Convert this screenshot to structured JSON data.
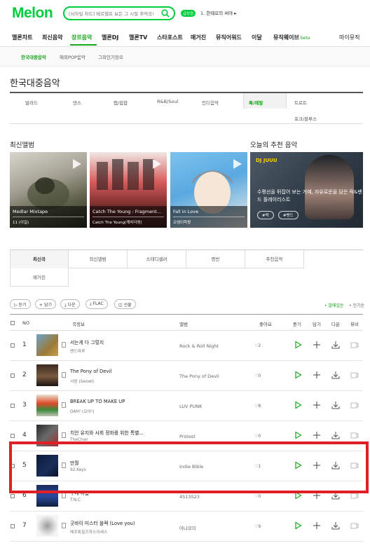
{
  "header": {
    "logo": "Melon",
    "search_placeholder": "[서하빌 차트] 메르헬프 보든 그 시절 추억곡!",
    "badge": "급상승",
    "trend": "1. 한때로의 써야 ▸"
  },
  "gnb": {
    "items": [
      "멜론차트",
      "최신음악",
      "장르음악",
      "멜론DJ",
      "멜론TV",
      "스타포스트",
      "매거진",
      "뮤직어워드",
      "이달",
      "뮤직웨이브",
      "마이뮤직"
    ],
    "beta": "beta"
  },
  "subnav": {
    "items": [
      "한국대중음악",
      "해외POP음악",
      "그외인기장르"
    ]
  },
  "page_title": "한국대중음악",
  "genres": [
    "발라드",
    "댄스",
    "랩/힙합",
    "R&B/Soul",
    "인디음악",
    "록/메탈",
    "트로트",
    "포크/블루스"
  ],
  "sections": {
    "new_albums": "최신앨범",
    "recommend": "오늘의 추천 음악"
  },
  "albums": [
    {
      "title": "Medlar Mixtape",
      "artist": "11 (이일)"
    },
    {
      "title": "Catch The Young : Fragment...",
      "artist": "Catch The Young(캐치더영)"
    },
    {
      "title": "Fall in Love",
      "artist": "오엠이학왕"
    }
  ],
  "recommend": {
    "dj": "DJ JUUU",
    "text": "수평선을 뒤집어 보는 거예, 자유로운을 담은 락&밴드 플레이리스트",
    "tags": [
      "#락",
      "#밴드"
    ]
  },
  "tabs": [
    "최신곡",
    "최신앨범",
    "스테디셀러",
    "명반",
    "추천음악",
    "매거진"
  ],
  "actions": {
    "buttons": [
      "듣기",
      "담기",
      "다운",
      "FLAC",
      "선물"
    ],
    "toggle_on": "• 발매일순",
    "toggle_off": "• 인기순"
  },
  "table": {
    "headers": [
      "NO",
      "곡정보",
      "앨범",
      "좋아요",
      "듣기",
      "담기",
      "다운",
      "뮤비"
    ],
    "rows": [
      {
        "rank": "1",
        "title": "서는게 다 그렇지",
        "artist": "밴드마루",
        "album": "Rock & Roll Night",
        "likes": "2"
      },
      {
        "rank": "2",
        "title": "The Pony of Devil",
        "artist": "서웅 (Seowl)",
        "album": "The Pony of Devil",
        "likes": "0"
      },
      {
        "rank": "3",
        "title": "BREAK UP TO MAKE UP",
        "artist": "OAH! (오아!)",
        "album": "LUV PUNK",
        "likes": "8"
      },
      {
        "rank": "4",
        "title": "치안 유지와 사회 정화를 위한 특별...",
        "artist": "TheChan",
        "album": "Protest",
        "likes": "0"
      },
      {
        "rank": "5",
        "title": "만월",
        "artist": "92.Keys",
        "album": "Indie Bible",
        "likes": "1"
      },
      {
        "rank": "6",
        "title": "구네 이름",
        "artist": "T.N.C",
        "album": "4S13S23",
        "likes": "0"
      },
      {
        "rank": "7",
        "title": "굿바이 미스터 블랙 (Love you)",
        "artist": "메조특필즈하스이세스",
        "album": "아나모미",
        "likes": "9"
      }
    ]
  },
  "colors": {
    "brand": "#00cd3c",
    "accent": "#1aa81e",
    "highlight": "#e11f26"
  }
}
